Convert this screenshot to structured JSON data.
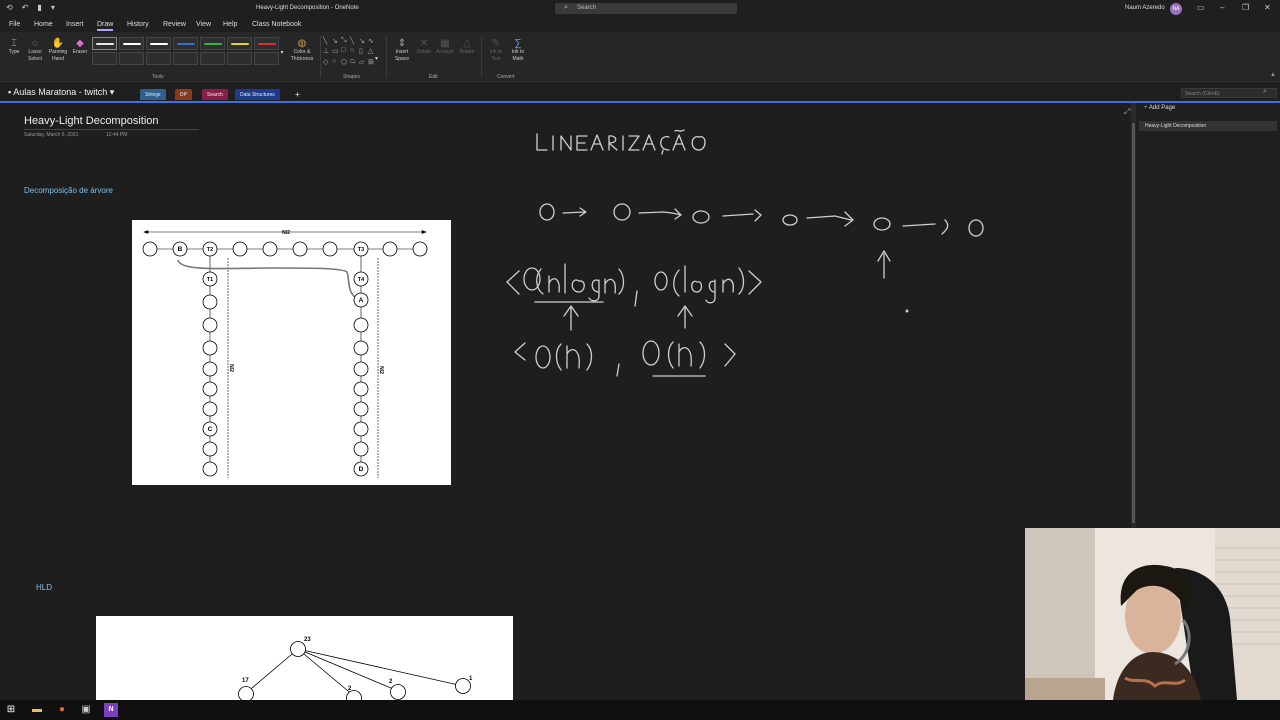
{
  "titlebar": {
    "title": "Heavy-Light Decomposition - OneNote",
    "search_placeholder": "Search",
    "user_name": "Naum Azeredo",
    "user_initials": "NA"
  },
  "menu": {
    "items": [
      "File",
      "Home",
      "Insert",
      "Draw",
      "History",
      "Review",
      "View",
      "Help",
      "Class Notebook"
    ],
    "active": "Draw"
  },
  "ribbon": {
    "tools": {
      "type": "Type",
      "lasso": "Lasso\nSelect",
      "panning": "Panning\nHand",
      "eraser": "Eraser",
      "color_thickness": "Color &\nThickness",
      "group": "Tools"
    },
    "shapes_group": "Shapes",
    "edit": {
      "insert_space": "Insert\nSpace",
      "delete": "Delete",
      "arrange": "Arrange",
      "rotate": "Rotate",
      "group": "Edit"
    },
    "convert": {
      "ink_to_text": "Ink to\nText",
      "ink_to_math": "Ink to\nMath",
      "group": "Convert"
    },
    "pen_colors": [
      "#e8e8e8",
      "#ffffff",
      "#ffffff",
      "#3a6fd8",
      "#2fb34a",
      "#e6d21a",
      "#d23434"
    ]
  },
  "notebook": {
    "name": "Aulas Maratona - twitch",
    "tabs": [
      {
        "label": "Strings",
        "color": "#2f5f8f"
      },
      {
        "label": "DP",
        "color": "#8a3a1e"
      },
      {
        "label": "Search",
        "color": "#8a1e4a"
      },
      {
        "label": "Data Structures",
        "color": "#1e3a8a"
      }
    ],
    "add_tab": "+",
    "search_placeholder": "Search (Ctrl+E)"
  },
  "page": {
    "title": "Heavy-Light Decomposition",
    "date": "Saturday, March 6, 2021",
    "time": "12:44 PM",
    "section1_heading": "Decomposição de árvore",
    "section2_heading": "HLD"
  },
  "diagram1": {
    "top_label": "N/2",
    "left_vertical_label": "N/2",
    "right_vertical_label": "N/2",
    "node_labels": {
      "b": "B",
      "t2": "T2",
      "t3": "T3",
      "t1": "T1",
      "t4": "T4",
      "a": "A",
      "c": "C",
      "d": "D"
    }
  },
  "diagram2": {
    "labels": [
      "23",
      "17",
      "2",
      "2",
      "1"
    ]
  },
  "pagelist": {
    "add_page": "Add Page",
    "pages": [
      "Heavy-Light Decomposition"
    ]
  }
}
